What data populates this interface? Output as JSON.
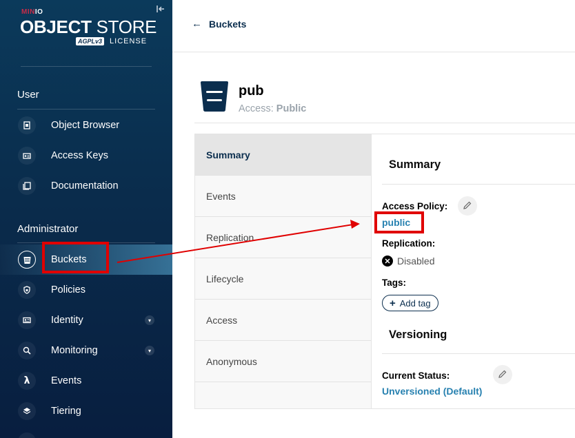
{
  "sidebar": {
    "brand_top_m": "MIN",
    "brand_top_io": "IO",
    "brand_main_bold": "OBJECT",
    "brand_main_light": " STORE",
    "brand_badge": "AGPLv3",
    "brand_license": "LICENSE",
    "user_section": "User",
    "admin_section": "Administrator",
    "user_items": [
      {
        "label": "Object Browser",
        "icon": "object-browser-icon"
      },
      {
        "label": "Access Keys",
        "icon": "access-keys-icon"
      },
      {
        "label": "Documentation",
        "icon": "documentation-icon"
      }
    ],
    "admin_items": [
      {
        "label": "Buckets",
        "icon": "bucket-icon",
        "active": true
      },
      {
        "label": "Policies",
        "icon": "shield-icon"
      },
      {
        "label": "Identity",
        "icon": "id-card-icon",
        "expandable": true
      },
      {
        "label": "Monitoring",
        "icon": "monitoring-icon",
        "expandable": true
      },
      {
        "label": "Events",
        "icon": "lambda-icon"
      },
      {
        "label": "Tiering",
        "icon": "layers-icon"
      }
    ]
  },
  "header": {
    "back_label": "Buckets"
  },
  "bucket": {
    "name": "pub",
    "access_label": "Access: ",
    "access_value": "Public"
  },
  "tabs": [
    "Summary",
    "Events",
    "Replication",
    "Lifecycle",
    "Access",
    "Anonymous"
  ],
  "summary": {
    "heading": "Summary",
    "access_policy_label": "Access Policy:",
    "access_policy_value": "public",
    "replication_label": "Replication:",
    "replication_value": "Disabled",
    "tags_label": "Tags:",
    "add_tag_label": "Add tag"
  },
  "versioning": {
    "heading": "Versioning",
    "current_status_label": "Current Status:",
    "current_status_value": "Unversioned (Default)"
  },
  "colors": {
    "sidebar_bg": "#0b2e4e",
    "link": "#2781b0",
    "highlight": "#e00000"
  }
}
